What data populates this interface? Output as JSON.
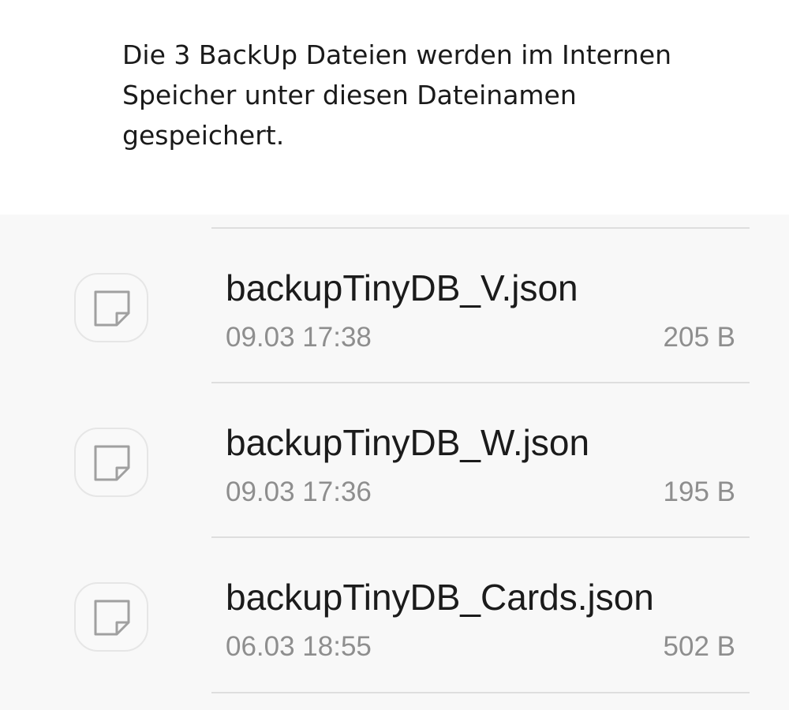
{
  "caption": "Die 3 BackUp Dateien werden im Internen\nSpeicher unter diesen Dateinamen\ngespeichert.",
  "files": [
    {
      "name": "backupTinyDB_V.json",
      "date": "09.03 17:38",
      "size": "205 B",
      "icon": "document-icon"
    },
    {
      "name": "backupTinyDB_W.json",
      "date": "09.03 17:36",
      "size": "195 B",
      "icon": "document-icon"
    },
    {
      "name": "backupTinyDB_Cards.json",
      "date": "06.03 18:55",
      "size": "502 B",
      "icon": "document-icon"
    }
  ],
  "colors": {
    "list_background": "#f8f8f8",
    "primary_text": "#1b1b1b",
    "secondary_text": "#8e8e8e",
    "divider": "#dedede",
    "icon_stroke": "#a0a0a0"
  }
}
